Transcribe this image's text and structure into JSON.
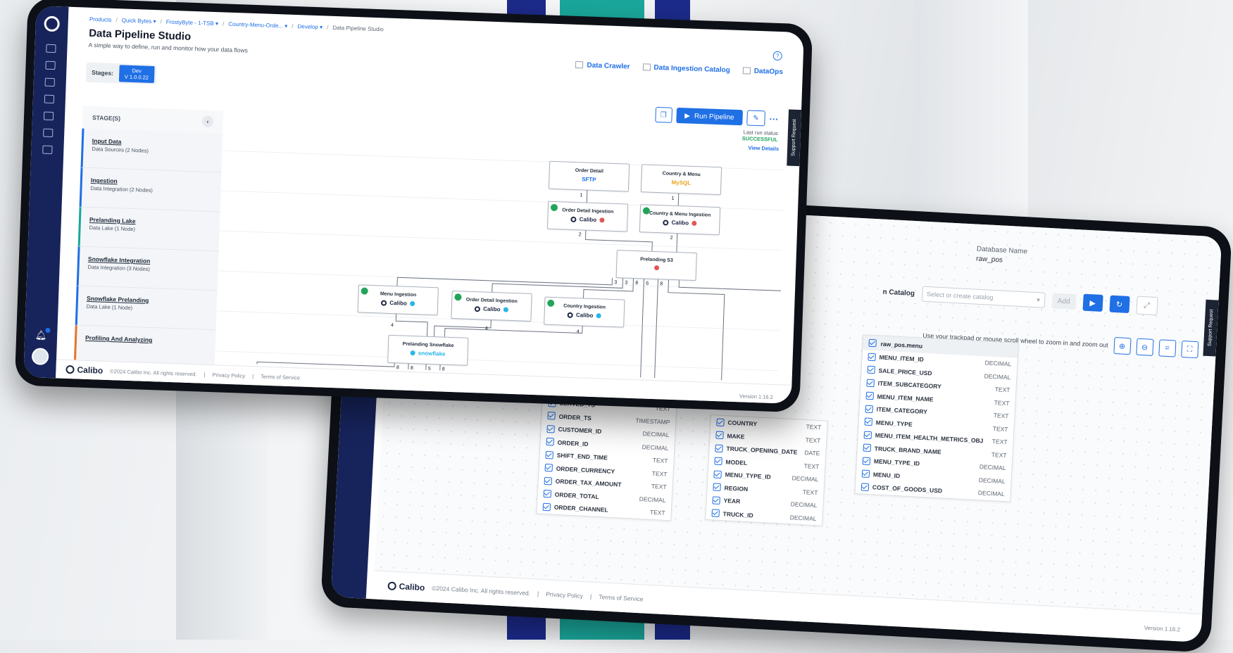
{
  "back_screen": {
    "database_name_label": "Database Name",
    "database_name_value": "raw_pos",
    "catalog_label": "n Catalog",
    "catalog_placeholder": "Select or create catalog",
    "add_label": "Add",
    "zoom_hint": "Use your trackpad or mouse scroll wheel to zoom in and zoom out",
    "support_tab": "Support Request",
    "footer_brand": "Calibo",
    "footer_copyright": "©2024 Calibo Inc. All rights reserved.",
    "footer_privacy": "Privacy Policy",
    "footer_terms": "Terms of Service",
    "version": "Version 1.16.2",
    "table_left": {
      "rows": [
        {
          "name": "SERVED_TS",
          "type": "TEXT"
        },
        {
          "name": "ORDER_TS",
          "type": "TIMESTAMP"
        },
        {
          "name": "CUSTOMER_ID",
          "type": "DECIMAL"
        },
        {
          "name": "ORDER_ID",
          "type": "DECIMAL"
        },
        {
          "name": "SHIFT_END_TIME",
          "type": "TEXT"
        },
        {
          "name": "ORDER_CURRENCY",
          "type": "TEXT"
        },
        {
          "name": "ORDER_TAX_AMOUNT",
          "type": "TEXT"
        },
        {
          "name": "ORDER_TOTAL",
          "type": "DECIMAL"
        },
        {
          "name": "ORDER_CHANNEL",
          "type": "TEXT"
        }
      ]
    },
    "table_mid": {
      "rows": [
        {
          "name": "COUNTRY",
          "type": "TEXT"
        },
        {
          "name": "MAKE",
          "type": "TEXT"
        },
        {
          "name": "TRUCK_OPENING_DATE",
          "type": "DATE"
        },
        {
          "name": "MODEL",
          "type": "TEXT"
        },
        {
          "name": "MENU_TYPE_ID",
          "type": "DECIMAL"
        },
        {
          "name": "REGION",
          "type": "TEXT"
        },
        {
          "name": "YEAR",
          "type": "DECIMAL"
        },
        {
          "name": "TRUCK_ID",
          "type": "DECIMAL"
        }
      ]
    },
    "table_right": {
      "title": "raw_pos.menu",
      "rows": [
        {
          "name": "MENU_ITEM_ID",
          "type": "DECIMAL"
        },
        {
          "name": "SALE_PRICE_USD",
          "type": "DECIMAL"
        },
        {
          "name": "ITEM_SUBCATEGORY",
          "type": "TEXT"
        },
        {
          "name": "MENU_ITEM_NAME",
          "type": "TEXT"
        },
        {
          "name": "ITEM_CATEGORY",
          "type": "TEXT"
        },
        {
          "name": "MENU_TYPE",
          "type": "TEXT"
        },
        {
          "name": "MENU_ITEM_HEALTH_METRICS_OBJ",
          "type": "TEXT"
        },
        {
          "name": "TRUCK_BRAND_NAME",
          "type": "TEXT"
        },
        {
          "name": "MENU_TYPE_ID",
          "type": "DECIMAL"
        },
        {
          "name": "MENU_ID",
          "type": "DECIMAL"
        },
        {
          "name": "COST_OF_GOODS_USD",
          "type": "DECIMAL"
        }
      ]
    }
  },
  "front_screen": {
    "breadcrumbs": {
      "b1": "Products",
      "b2": "Quick Bytes ▾",
      "b3": "FrostyByte - 1-TSB ▾",
      "b4": "Country-Menu-Orde... ▾",
      "b5": "Develop ▾",
      "b6": "Data Pipeline Studio"
    },
    "title": "Data Pipeline Studio",
    "subtitle": "A simple way to define, run and monitor how your data flows",
    "links": {
      "data_crawler": "Data Crawler",
      "ingestion_catalog": "Data Ingestion Catalog",
      "dataops": "DataOps"
    },
    "stages_label": "Stages:",
    "stage_dev_name": "Dev",
    "stage_dev_version": "V 1.0.0.22",
    "run_pipeline": "Run Pipeline",
    "panel_title": "STAGE(S)",
    "stages": [
      {
        "name": "Input Data",
        "desc": "Data Sources (2 Nodes)"
      },
      {
        "name": "Ingestion",
        "desc": "Data Integration (2 Nodes)"
      },
      {
        "name": "Prelanding Lake",
        "desc": "Data Lake (1 Node)"
      },
      {
        "name": "Snowflake Integration",
        "desc": "Data Integration (3 Nodes)"
      },
      {
        "name": "Snowflake Prelanding",
        "desc": "Data Lake (1 Node)"
      },
      {
        "name": "Profiling And Analyzing",
        "desc": ""
      }
    ],
    "last_run_label": "Last run status",
    "last_run_status": "SUCCESSFUL",
    "view_details": "View Details",
    "nodes": {
      "order_detail": {
        "title": "Order Detail",
        "sub": "SFTP"
      },
      "country_menu": {
        "title": "Country & Menu",
        "sub": "MySQL"
      },
      "order_detail_ingestion": {
        "title": "Order Detail Ingestion",
        "sub": "Calibo"
      },
      "country_menu_ingestion": {
        "title": "Country & Menu Ingestion",
        "sub": "Calibo"
      },
      "prelanding_s3": {
        "title": "Prelanding S3",
        "sub": ""
      },
      "menu_ingestion": {
        "title": "Menu Ingestion",
        "sub": "Calibo"
      },
      "order_detail_ingestion_2": {
        "title": "Order Detail Ingestion",
        "sub": "Calibo"
      },
      "country_ingestion": {
        "title": "Country Ingestion",
        "sub": "Calibo"
      },
      "prelanding_snowflake": {
        "title": "Prelanding Snowflake",
        "sub": "snowflake"
      }
    },
    "edge_labels": {
      "e1": "1",
      "e2": "1",
      "e3": "2",
      "e4": "2",
      "e5": "3",
      "e6": "3",
      "e7": "8",
      "e8": "6",
      "e9": "8",
      "e10": "4",
      "e11": "4",
      "e12": "4",
      "e13": "8",
      "e14": "8",
      "e15": "5",
      "e16": "8"
    },
    "support_tab": "Support Request",
    "footer_brand": "Calibo",
    "footer_copyright": "©2024 Calibo Inc. All rights reserved.",
    "footer_privacy": "Privacy Policy",
    "footer_terms": "Terms of Service",
    "version": "Version 1.16.2"
  },
  "colors": {
    "accent": "#1f6fe5",
    "rail": "#17245c",
    "success": "#22a55a"
  }
}
